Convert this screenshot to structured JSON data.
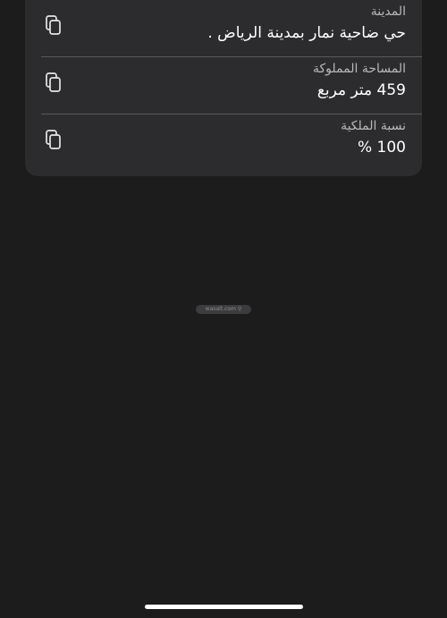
{
  "details": {
    "rows": [
      {
        "label": "المدينة",
        "value": "حي  ضاحية نمار  بمدينة الرياض .",
        "copy_icon": "copy-icon"
      },
      {
        "label": "المساحة المملوكة",
        "value": "459 متر مربع",
        "copy_icon": "copy-icon"
      },
      {
        "label": "نسبة الملكية",
        "value": "100 %",
        "copy_icon": "copy-icon"
      }
    ]
  },
  "watermark": {
    "text": "wasalt.com ⚲"
  },
  "colors": {
    "background": "#1c1c1c",
    "card": "#2c2c2e",
    "divider": "#5a5a5d",
    "label": "#b8b8bc",
    "value": "#ffffff"
  }
}
